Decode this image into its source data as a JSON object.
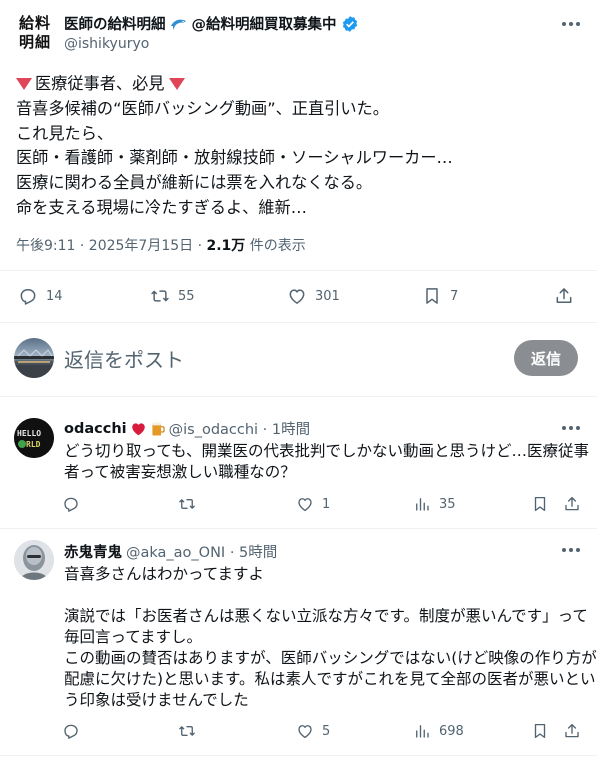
{
  "main_tweet": {
    "avatar_text_top": "給料",
    "avatar_text_bottom": "明細",
    "display_name": "医師の給料明細",
    "display_name_suffix": "@給料明細買取募集中",
    "handle": "@ishikyuryo",
    "body_lines": [
      "医療従事者、必見",
      "音喜多候補の“医師バッシング動画”、正直引いた。",
      "これ見たら、",
      "医師・看護師・薬剤師・放射線技師・ソーシャルワーカー…",
      "医療に関わる全員が維新には票を入れなくなる。",
      "命を支える現場に冷たすぎるよ、維新…"
    ],
    "time": "午後9:11 · 2025年7月15日 · ",
    "views_count": "2.1万",
    "views_label": " 件の表示",
    "stats": {
      "replies": "14",
      "retweets": "55",
      "likes": "301",
      "bookmarks": "7"
    }
  },
  "reply_box": {
    "placeholder": "返信をポスト",
    "button_label": "返信"
  },
  "replies": [
    {
      "display_name": "odacchi",
      "handle_time": "@is_odacchi · 1時間",
      "avatar_text_top": "HELLO",
      "avatar_text_bottom": "RLD",
      "body_lines": [
        "どう切り取っても、開業医の代表批判でしかない動画と思うけど…医療従事",
        "者って被害妄想激しい職種なの？"
      ],
      "stats": {
        "replies": "",
        "retweets": "",
        "likes": "1",
        "views": "35"
      }
    },
    {
      "display_name": "赤鬼青鬼",
      "handle_time": "@aka_ao_ONI · 5時間",
      "body_lines": [
        "音喜多さんはわかってますよ",
        "",
        "演説では「お医者さんは悪くない立派な方々です。制度が悪いんです」って",
        "毎回言ってますし。",
        "この動画の賛否はありますが、医師バッシングではない(けど映像の作り方が",
        "配慮に欠けた)と思います。私は素人ですがこれを見て全部の医者が悪いとい",
        "う印象は受けませんでした"
      ],
      "stats": {
        "replies": "",
        "retweets": "",
        "likes": "5",
        "views": "698"
      }
    }
  ],
  "colors": {
    "accent_verified": "#1d9bf0",
    "triangle": "#e0455a",
    "heart": "#d81b3c",
    "muted": "#536471"
  },
  "icons": [
    "more-icon",
    "verified-icon",
    "dolphin-icon",
    "reply-icon",
    "retweet-icon",
    "like-icon",
    "bookmark-icon",
    "share-icon",
    "views-icon",
    "heart-emoji-icon",
    "beer-emoji-icon"
  ]
}
